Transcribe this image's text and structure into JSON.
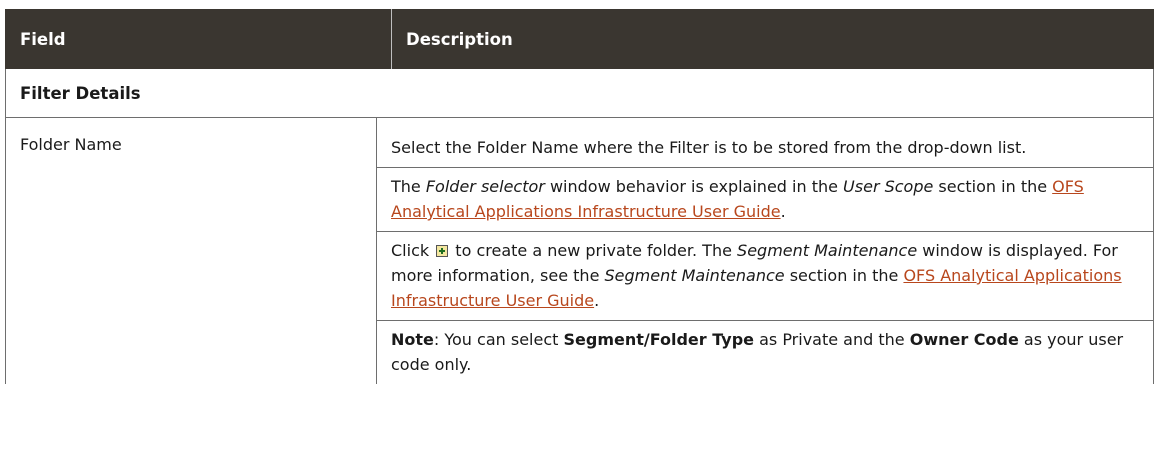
{
  "header": {
    "field_label": "Field",
    "description_label": "Description"
  },
  "section": {
    "title": "Filter Details"
  },
  "row": {
    "field": "Folder Name",
    "p1": "Select the Folder Name where the Filter is to be stored from the drop-down list.",
    "p2": {
      "t1": "The ",
      "i1": "Folder selector",
      "t2": " window behavior is explained in the ",
      "i2": "User Scope",
      "t3": " section in the ",
      "link": "OFS Analytical Applications Infrastructure User Guide",
      "t4": "."
    },
    "p3": {
      "t1": "Click ",
      "icon": "new-folder-icon",
      "t2": " to create a new private folder. The ",
      "i1": "Segment Maintenance",
      "t3": " window is displayed. For more information, see the ",
      "i2": "Segment Maintenance",
      "t4": " section in the ",
      "link": "OFS Analytical Applications Infrastructure User Guide",
      "t5": "."
    },
    "p4": {
      "b1": "Note",
      "t1": ": You can select ",
      "b2": "Segment/Folder Type",
      "t2": " as Private and the ",
      "b3": "Owner Code",
      "t3": " as your user code only."
    }
  }
}
